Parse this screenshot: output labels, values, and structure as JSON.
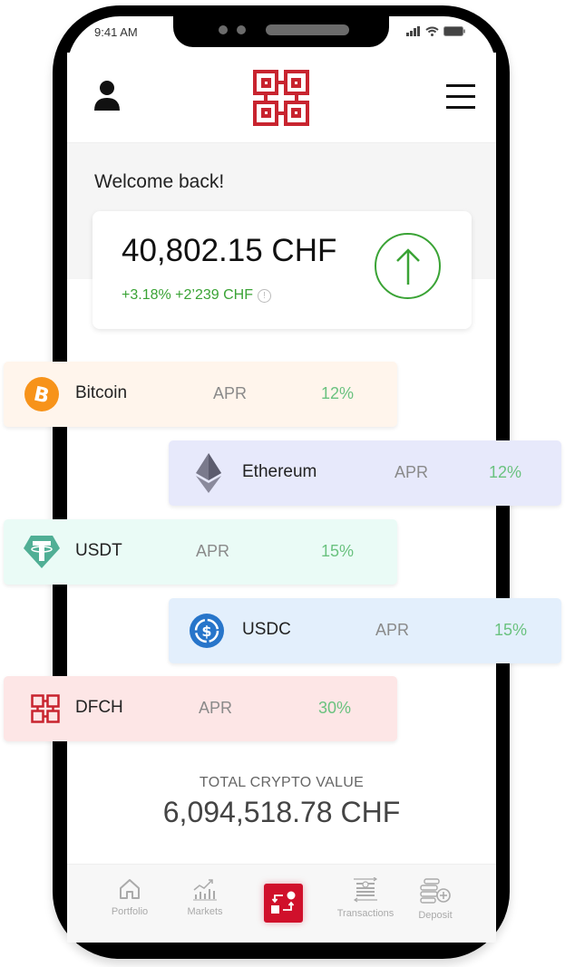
{
  "status_bar": {
    "time": "9:41 AM"
  },
  "header": {
    "profile_icon": "user-icon",
    "logo": "dfch-logo",
    "menu_icon": "hamburger-menu-icon"
  },
  "greeting": "Welcome back!",
  "balance": {
    "amount": "40,802.15 CHF",
    "change": "+3.18% +2’239 CHF",
    "trend_icon": "arrow-up-icon"
  },
  "coins": [
    {
      "name": "Bitcoin",
      "apr_label": "APR",
      "rate": "12%",
      "icon": "bitcoin-icon",
      "bg": "#fff5ec"
    },
    {
      "name": "Ethereum",
      "apr_label": "APR",
      "rate": "12%",
      "icon": "ethereum-icon",
      "bg": "#e7e9fb"
    },
    {
      "name": "USDT",
      "apr_label": "APR",
      "rate": "15%",
      "icon": "tether-icon",
      "bg": "#eafbf6"
    },
    {
      "name": "USDC",
      "apr_label": "APR",
      "rate": "15%",
      "icon": "usdc-icon",
      "bg": "#e3effc"
    },
    {
      "name": "DFCH",
      "apr_label": "APR",
      "rate": "30%",
      "icon": "dfch-icon",
      "bg": "#fde6e6"
    }
  ],
  "total": {
    "label": "TOTAL CRYPTO VALUE",
    "value": "6,094,518.78 CHF"
  },
  "tabbar": {
    "items": [
      {
        "label": "Portfolio",
        "icon": "home-icon"
      },
      {
        "label": "Markets",
        "icon": "chart-icon"
      },
      {
        "label": "",
        "icon": "exchange-icon"
      },
      {
        "label": "Transactions",
        "icon": "transactions-icon"
      },
      {
        "label": "Deposit",
        "icon": "deposit-icon"
      }
    ]
  },
  "colors": {
    "accent_red": "#d0102b",
    "positive_green": "#3aa335",
    "rate_green": "#6ac27f"
  }
}
